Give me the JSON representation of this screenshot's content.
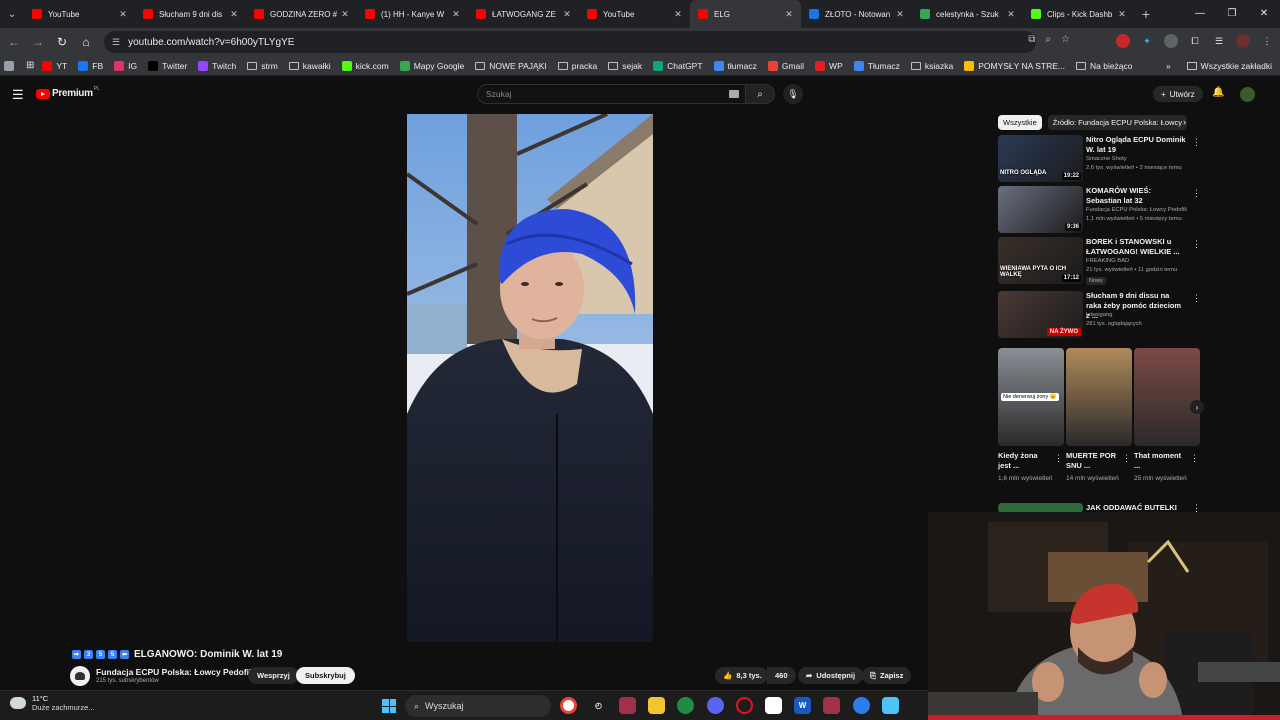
{
  "browser": {
    "tabs": [
      {
        "title": "YouTube",
        "fav_color": "#ff0000",
        "active": false
      },
      {
        "title": "Słucham 9 dni dis",
        "fav_color": "#ff0000",
        "active": false
      },
      {
        "title": "GODZINA ZERO #",
        "fav_color": "#ff0000",
        "active": false
      },
      {
        "title": "(1) HH - Kanye W",
        "fav_color": "#ff0000",
        "active": false
      },
      {
        "title": "ŁATWOGANG ZE",
        "fav_color": "#ff0000",
        "active": false
      },
      {
        "title": "YouTube",
        "fav_color": "#ff0000",
        "active": false
      },
      {
        "title": "ELG",
        "fav_color": "#ff0000",
        "active": true
      },
      {
        "title": "ZŁOTO - Notowan",
        "fav_color": "#1a73e8",
        "active": false
      },
      {
        "title": "celestynka - Szuk",
        "fav_color": "#34a853",
        "active": false
      },
      {
        "title": "Clips - Kick Dashb",
        "fav_color": "#53fc18",
        "active": false
      }
    ],
    "url": "youtube.com/watch?v=6h00yTLYgYE",
    "bookmarks": [
      {
        "label": "YT",
        "icon": "youtube-icon",
        "color": "#ff0000"
      },
      {
        "label": "FB",
        "icon": "facebook-icon",
        "color": "#1877f2"
      },
      {
        "label": "IG",
        "icon": "instagram-icon",
        "color": "#e1306c"
      },
      {
        "label": "Twitter",
        "icon": "x-icon",
        "color": "#000000"
      },
      {
        "label": "Twitch",
        "icon": "twitch-icon",
        "color": "#9146ff"
      },
      {
        "label": "strm",
        "icon": "folder-icon",
        "color": ""
      },
      {
        "label": "kawałki",
        "icon": "folder-icon",
        "color": ""
      },
      {
        "label": "kick.com",
        "icon": "kick-icon",
        "color": "#53fc18"
      },
      {
        "label": "Mapy Google",
        "icon": "maps-icon",
        "color": "#34a853"
      },
      {
        "label": "NOWE PAJĄKI",
        "icon": "folder-icon",
        "color": ""
      },
      {
        "label": "pracka",
        "icon": "folder-icon",
        "color": ""
      },
      {
        "label": "sejak",
        "icon": "folder-icon",
        "color": ""
      },
      {
        "label": "ChatGPT",
        "icon": "chatgpt-icon",
        "color": "#10a37f"
      },
      {
        "label": "tłumacz",
        "icon": "translate-icon",
        "color": "#4285f4"
      },
      {
        "label": "Gmail",
        "icon": "gmail-icon",
        "color": "#ea4335"
      },
      {
        "label": "WP",
        "icon": "wp-icon",
        "color": "#e31e24"
      },
      {
        "label": "Tłumacz",
        "icon": "translate-icon",
        "color": "#4285f4"
      },
      {
        "label": "ksiazka",
        "icon": "folder-icon",
        "color": ""
      },
      {
        "label": "POMYSŁY NA STRE...",
        "icon": "keep-icon",
        "color": "#fbbc04"
      },
      {
        "label": "Na bieżąco",
        "icon": "folder-icon",
        "color": ""
      }
    ],
    "all_bookmarks": "Wszystkie zakładki"
  },
  "youtube": {
    "logo_text": "Premium",
    "logo_region": "PL",
    "search_placeholder": "Szukaj",
    "create_label": "Utwórz",
    "video": {
      "title": "ELGANOWO: Dominik W. lat 19",
      "emoji_prefix": [
        "➡",
        "3",
        "5",
        "5",
        "⬅"
      ],
      "channel": "Fundacja ECPU Polska: Łowcy Pedofili",
      "subscribers": "215 tys. subskrybentów",
      "support_label": "Wesprzyj",
      "subscribe_label": "Subskrybuj",
      "likes": "8,3 tys.",
      "dislikes": "460",
      "share_label": "Udostępnij",
      "save_label": "Zapisz"
    },
    "chips": [
      "Wszystkie",
      "Źródło: Fundacja ECPU Polska: Łowcy"
    ],
    "recommendations": [
      {
        "title": "Nitro Ogląda ECPU Dominik W. lat 19",
        "channel": "Smaczne Shoty",
        "meta": "2,6 tys. wyświetleń • 2 miesiące temu",
        "duration": "19:22",
        "thumb_text": "NITRO OGLĄDA",
        "live": false,
        "badge": "",
        "thumb_color": "#2b3a55"
      },
      {
        "title": "KOMARÓW WIEŚ: Sebastian lat 32",
        "channel": "Fundacja ECPU Polska: Łowcy Pedofili",
        "meta": "1,1 mln wyświetleń • 5 miesięcy temu",
        "duration": "9:36",
        "thumb_text": "",
        "live": false,
        "badge": "",
        "thumb_color": "#6a6f80"
      },
      {
        "title": "BOREK i STANOWSKI u ŁATWOGANG! WIELKIE ...",
        "channel": "FREAKING BAD",
        "meta": "21 tys. wyświetleń • 11 godzin temu",
        "duration": "17:12",
        "thumb_text": "WIENIAWA PYTA O ICH WALKĘ",
        "live": false,
        "badge": "Nowy",
        "thumb_color": "#3a2f2a"
      },
      {
        "title": "Słucham 9 dni dissu na raka żeby pomóc dzieciom z ...",
        "channel": "latwogang",
        "meta": "281 tys. oglądających",
        "duration": "NA ŻYWO",
        "thumb_text": "",
        "live": true,
        "badge": "",
        "thumb_color": "#4a3a36"
      }
    ],
    "shorts": [
      {
        "title": "Kiedy żona jest ...",
        "views": "1,6 mln wyświetleń",
        "overlay": "Nie denerwuj żony 😠",
        "color": "#8a8f96"
      },
      {
        "title": "MUERTE POR SNU ...",
        "views": "14 mln wyświetleń",
        "overlay": "",
        "color": "#b08a5a"
      },
      {
        "title": "That moment ...",
        "views": "25 mln wyświetleń",
        "overlay": "",
        "color": "#7a4a45"
      }
    ],
    "next_rec_title": "JAK ODDAWAĆ BUTELKI DO ..."
  },
  "taskbar": {
    "temperature": "11°C",
    "weather": "Duże zachmurze...",
    "search_placeholder": "Wyszukaj"
  }
}
